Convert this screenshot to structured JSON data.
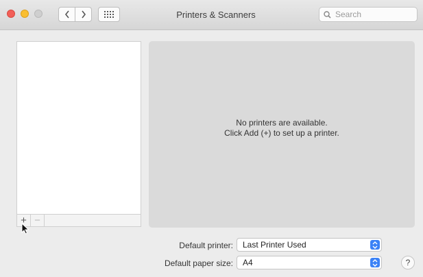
{
  "window": {
    "title": "Printers & Scanners"
  },
  "toolbar": {
    "back_icon": "chevron-left-icon",
    "forward_icon": "chevron-right-icon",
    "grid_icon": "show-all-grid-icon",
    "search_placeholder": "Search"
  },
  "printer_list": {
    "items": [],
    "add_label": "+",
    "remove_label": "−"
  },
  "detail": {
    "empty_line1": "No printers are available.",
    "empty_line2": "Click Add (+) to set up a printer."
  },
  "settings": {
    "default_printer_label": "Default printer:",
    "default_printer_value": "Last Printer Used",
    "default_paper_label": "Default paper size:",
    "default_paper_value": "A4"
  },
  "help": {
    "label": "?"
  },
  "colors": {
    "close": "#f25f58",
    "minimize": "#f9be31",
    "zoom": "#cfcfcf",
    "accent": "#3b82f6",
    "pane": "#dadada"
  }
}
